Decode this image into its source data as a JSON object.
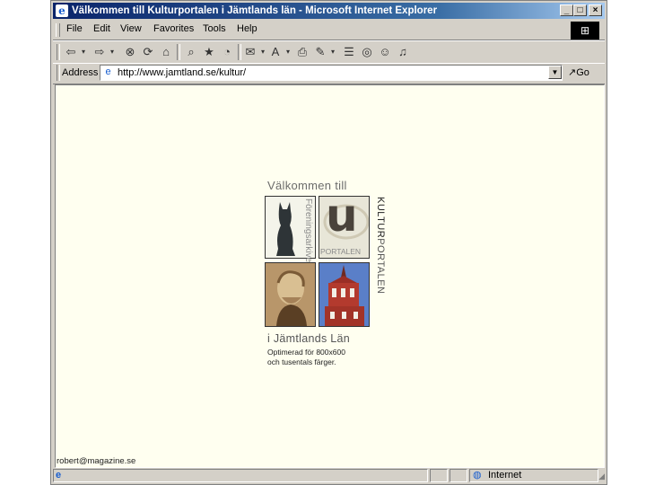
{
  "window": {
    "title": "Välkommen till Kulturportalen i Jämtlands län - Microsoft Internet Explorer",
    "minimize_glyph": "_",
    "maximize_glyph": "□",
    "close_glyph": "×"
  },
  "menu": {
    "items": [
      "File",
      "Edit",
      "View",
      "Favorites",
      "Tools",
      "Help"
    ]
  },
  "toolbar": {
    "icons": [
      "back-icon",
      "dropdown-icon",
      "forward-icon",
      "dropdown-icon",
      "stop-icon",
      "refresh-icon",
      "home-icon",
      "search-icon",
      "favorites-icon",
      "history-icon",
      "mail-icon",
      "print-icon",
      "edit-icon",
      "discuss-icon",
      "messenger-icon"
    ]
  },
  "address": {
    "label": "Address",
    "url": "http://www.jamtland.se/kultur/",
    "go_label": "Go"
  },
  "page": {
    "welcome": "Välkommen till",
    "tile1_vertical": "Föreningsarkivet",
    "big_letter": "u",
    "portalen_small": "PORTALEN",
    "kultur_word": "KULTUR",
    "portalen_word": "PORTALEN",
    "county": "i Jämtlands Län",
    "optimized_line1": "Optimerad för 800x600",
    "optimized_line2": "och tusentals färger.",
    "email": "robert@magazine.se"
  },
  "status": {
    "zone": "Internet"
  },
  "colors": {
    "titlebar": "#0a246a",
    "content_bg": "#fffff0",
    "chrome": "#d4d0c8"
  }
}
